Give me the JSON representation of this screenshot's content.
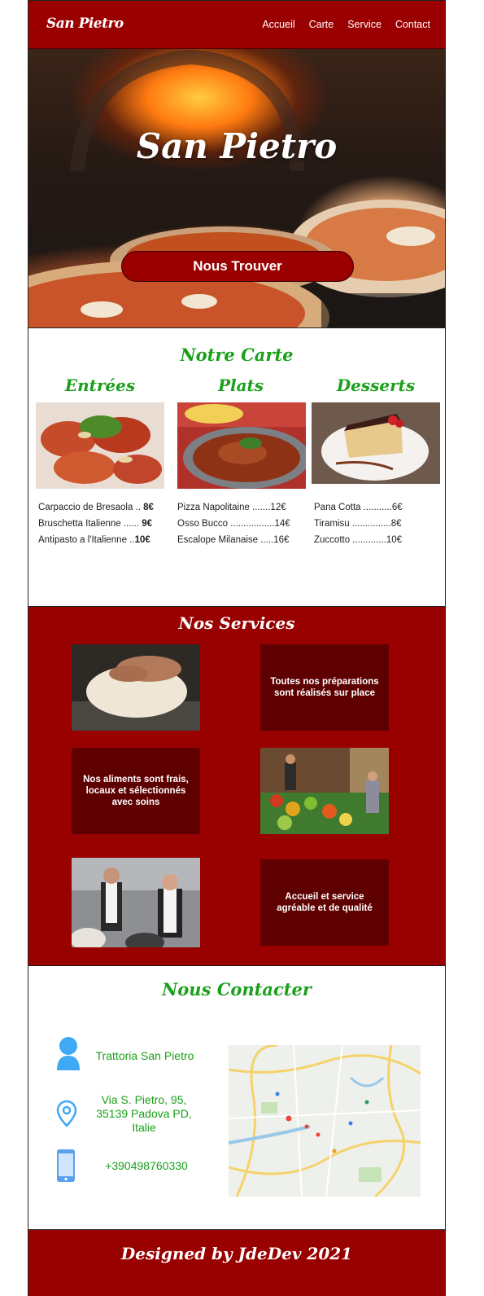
{
  "nav": {
    "brand": "San Pietro",
    "links": [
      "Accueil",
      "Carte",
      "Service",
      "Contact"
    ]
  },
  "hero": {
    "title": "San Pietro",
    "button_label": "Nous Trouver"
  },
  "carte": {
    "title": "Notre Carte",
    "columns": [
      {
        "title": "Entrées",
        "items": [
          {
            "name": "Carpaccio de Bresaola ..",
            "price": "8€"
          },
          {
            "name": "Bruschetta Italienne ......",
            "price": "9€"
          },
          {
            "name": "Antipasto a l'Italienne ..",
            "price": "10€"
          }
        ]
      },
      {
        "title": "Plats",
        "items": [
          {
            "name": "Pizza Napolitaine .......",
            "price": "12€"
          },
          {
            "name": "Osso Bucco .................",
            "price": "14€"
          },
          {
            "name": "Escalope Milanaise .....",
            "price": "16€"
          }
        ]
      },
      {
        "title": "Desserts",
        "items": [
          {
            "name": "Pana Cotta ...........",
            "price": "6€"
          },
          {
            "name": "Tiramisu ...............",
            "price": "8€"
          },
          {
            "name": "Zuccotto .............",
            "price": "10€"
          }
        ]
      }
    ]
  },
  "services": {
    "title": "Nos Services",
    "box1": "Toutes nos préparations sont réalisés sur place",
    "box2": "Nos aliments sont frais, locaux et sélectionnés avec soins",
    "box3": "Accueil et service agréable et de qualité"
  },
  "contact": {
    "title": "Nous Contacter",
    "name": "Trattoria San Pietro",
    "address_line1": "Via S. Pietro, 95,",
    "address_line2": "35139 Padova PD,",
    "address_line3": "Italie",
    "phone": "+390498760330"
  },
  "footer": {
    "text": "Designed by JdeDev 2021"
  },
  "colors": {
    "brand_red": "#9b0000",
    "dark_red_box": "#5e0000",
    "green_heading": "#1aa01a",
    "icon_blue": "#3fa9f5"
  }
}
